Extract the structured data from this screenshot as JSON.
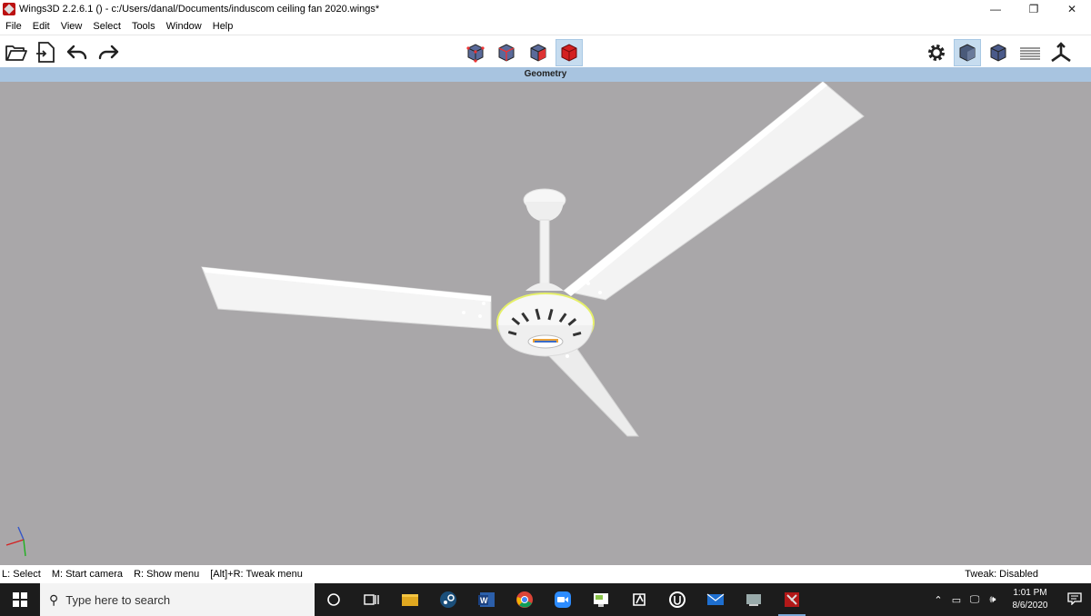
{
  "window": {
    "title": "Wings3D 2.2.6.1 () - c:/Users/danal/Documents/induscom ceiling fan 2020.wings*",
    "minimize": "—",
    "restore": "❐",
    "close": "✕"
  },
  "menu": [
    "File",
    "Edit",
    "View",
    "Select",
    "Tools",
    "Window",
    "Help"
  ],
  "viewport": {
    "header": "Geometry",
    "background": "#a9a7a9"
  },
  "status": {
    "left": [
      "L: Select",
      "M: Start camera",
      "R: Show menu",
      "[Alt]+R: Tweak menu"
    ],
    "right": "Tweak: Disabled"
  },
  "taskbar": {
    "search_placeholder": "Type here to search",
    "time": "1:01 PM",
    "date": "8/6/2020"
  }
}
